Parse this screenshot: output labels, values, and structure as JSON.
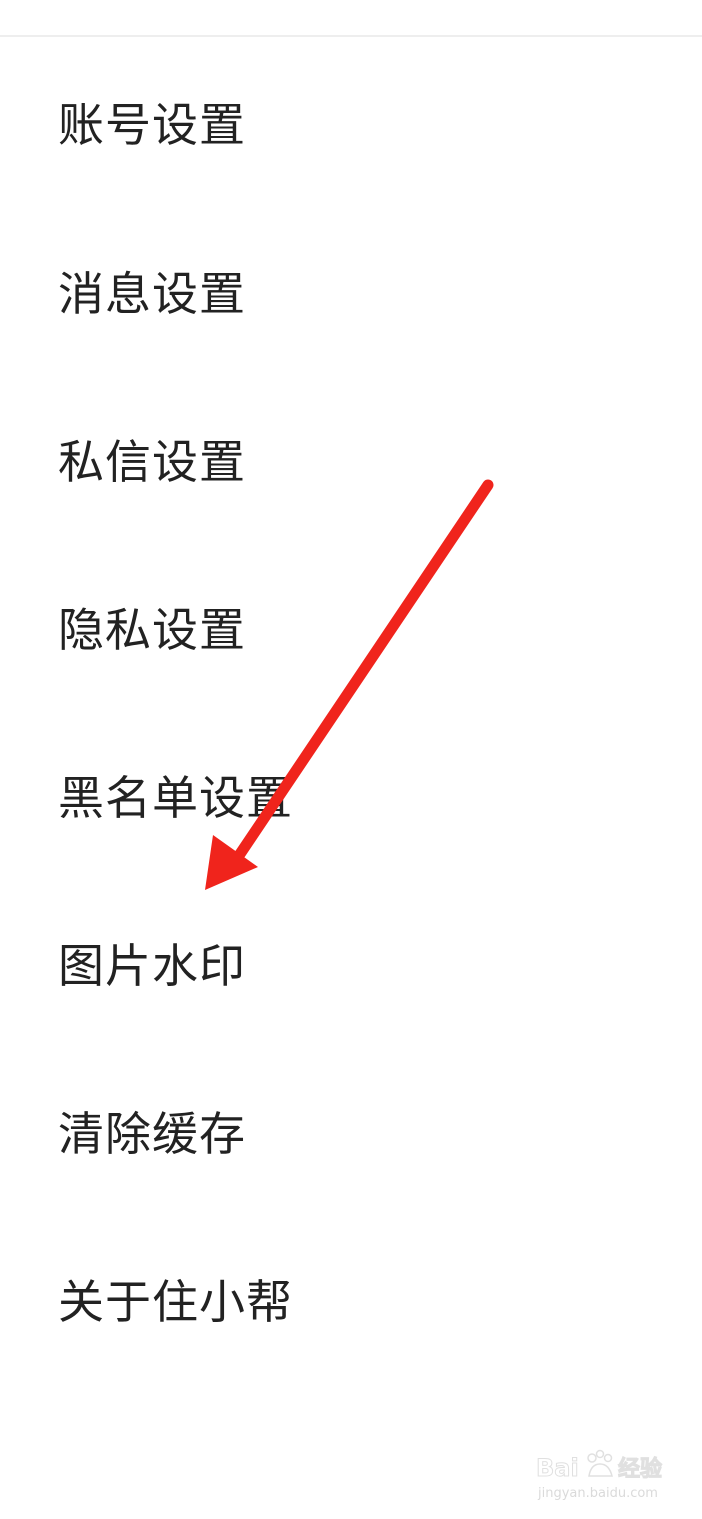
{
  "settings": {
    "items": [
      {
        "label": "账号设置"
      },
      {
        "label": "消息设置"
      },
      {
        "label": "私信设置"
      },
      {
        "label": "隐私设置"
      },
      {
        "label": "黑名单设置"
      },
      {
        "label": "图片水印"
      },
      {
        "label": "清除缓存"
      },
      {
        "label": "关于住小帮"
      }
    ]
  },
  "annotation": {
    "type": "arrow",
    "color": "#f0241c",
    "target": "图片水印"
  },
  "watermark": {
    "brand": "Baidu 经验",
    "url": "jingyan.baidu.com"
  }
}
